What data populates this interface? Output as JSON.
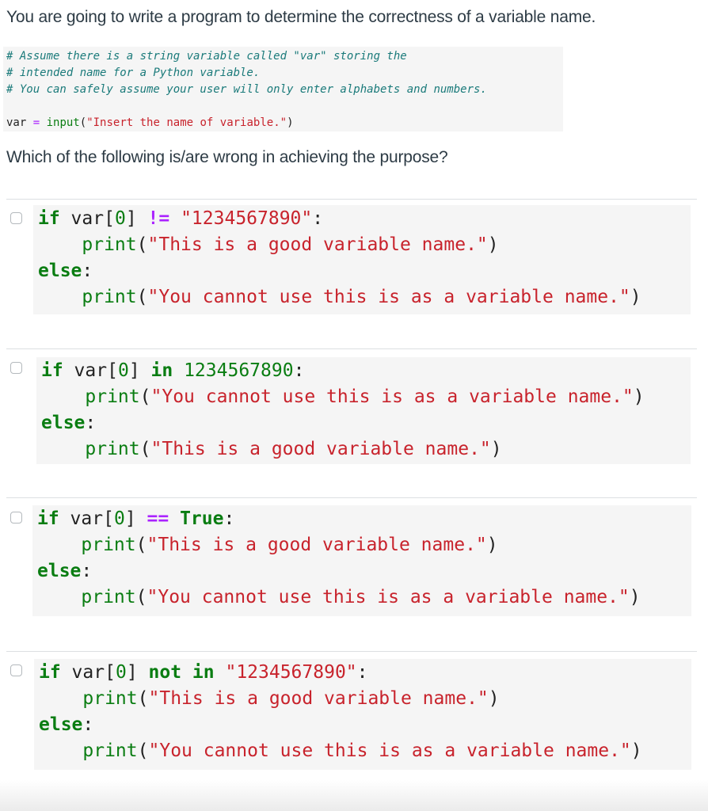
{
  "intro": "You are going to write a program to determine the correctness of a variable name.",
  "snippet": {
    "comments": [
      "# Assume there is a string variable called \"var\" storing the",
      "# intended name for a Python variable.",
      "# You can safely assume your user will only enter alphabets and numbers."
    ],
    "assign": {
      "var": "var",
      "op": " = ",
      "fn": "input",
      "open": "(",
      "str": "\"Insert the name of variable.\"",
      "close": ")"
    }
  },
  "question": "Which of the following is/are wrong in achieving the purpose?",
  "options": [
    {
      "checked": false,
      "line1": [
        {
          "t": "if",
          "c": "kw"
        },
        {
          "t": " var[",
          "c": "plain"
        },
        {
          "t": "0",
          "c": "num"
        },
        {
          "t": "] ",
          "c": "plain"
        },
        {
          "t": "!=",
          "c": "op"
        },
        {
          "t": " ",
          "c": "plain"
        },
        {
          "t": "\"1234567890\"",
          "c": "str"
        },
        {
          "t": ":",
          "c": "plain"
        }
      ],
      "line2": [
        {
          "t": "    ",
          "c": "plain"
        },
        {
          "t": "print",
          "c": "fn"
        },
        {
          "t": "(",
          "c": "plain"
        },
        {
          "t": "\"This is a good variable name.\"",
          "c": "str"
        },
        {
          "t": ")",
          "c": "plain"
        }
      ],
      "line3": [
        {
          "t": "else",
          "c": "kw"
        },
        {
          "t": ":",
          "c": "plain"
        }
      ],
      "line4": [
        {
          "t": "    ",
          "c": "plain"
        },
        {
          "t": "print",
          "c": "fn"
        },
        {
          "t": "(",
          "c": "plain"
        },
        {
          "t": "\"You cannot use this is as a variable name.\"",
          "c": "str"
        },
        {
          "t": ")",
          "c": "plain"
        }
      ]
    },
    {
      "checked": false,
      "line1": [
        {
          "t": "if",
          "c": "kw"
        },
        {
          "t": " var[",
          "c": "plain"
        },
        {
          "t": "0",
          "c": "num"
        },
        {
          "t": "] ",
          "c": "plain"
        },
        {
          "t": "in",
          "c": "kw"
        },
        {
          "t": " ",
          "c": "plain"
        },
        {
          "t": "1234567890",
          "c": "num"
        },
        {
          "t": ":",
          "c": "plain"
        }
      ],
      "line2": [
        {
          "t": "    ",
          "c": "plain"
        },
        {
          "t": "print",
          "c": "fn"
        },
        {
          "t": "(",
          "c": "plain"
        },
        {
          "t": "\"You cannot use this is as a variable name.\"",
          "c": "str"
        },
        {
          "t": ")",
          "c": "plain"
        }
      ],
      "line3": [
        {
          "t": "else",
          "c": "kw"
        },
        {
          "t": ":",
          "c": "plain"
        }
      ],
      "line4": [
        {
          "t": "    ",
          "c": "plain"
        },
        {
          "t": "print",
          "c": "fn"
        },
        {
          "t": "(",
          "c": "plain"
        },
        {
          "t": "\"This is a good variable name.\"",
          "c": "str"
        },
        {
          "t": ")",
          "c": "plain"
        }
      ]
    },
    {
      "checked": false,
      "line1": [
        {
          "t": "if",
          "c": "kw"
        },
        {
          "t": " var[",
          "c": "plain"
        },
        {
          "t": "0",
          "c": "num"
        },
        {
          "t": "] ",
          "c": "plain"
        },
        {
          "t": "==",
          "c": "op"
        },
        {
          "t": " ",
          "c": "plain"
        },
        {
          "t": "True",
          "c": "kw"
        },
        {
          "t": ":",
          "c": "plain"
        }
      ],
      "line2": [
        {
          "t": "    ",
          "c": "plain"
        },
        {
          "t": "print",
          "c": "fn"
        },
        {
          "t": "(",
          "c": "plain"
        },
        {
          "t": "\"This is a good variable name.\"",
          "c": "str"
        },
        {
          "t": ")",
          "c": "plain"
        }
      ],
      "line3": [
        {
          "t": "else",
          "c": "kw"
        },
        {
          "t": ":",
          "c": "plain"
        }
      ],
      "line4": [
        {
          "t": "    ",
          "c": "plain"
        },
        {
          "t": "print",
          "c": "fn"
        },
        {
          "t": "(",
          "c": "plain"
        },
        {
          "t": "\"You cannot use this is as a variable name.\"",
          "c": "str"
        },
        {
          "t": ")",
          "c": "plain"
        }
      ]
    },
    {
      "checked": false,
      "line1": [
        {
          "t": "if",
          "c": "kw"
        },
        {
          "t": " var[",
          "c": "plain"
        },
        {
          "t": "0",
          "c": "num"
        },
        {
          "t": "] ",
          "c": "plain"
        },
        {
          "t": "not in",
          "c": "kw"
        },
        {
          "t": " ",
          "c": "plain"
        },
        {
          "t": "\"1234567890\"",
          "c": "str"
        },
        {
          "t": ":",
          "c": "plain"
        }
      ],
      "line2": [
        {
          "t": "    ",
          "c": "plain"
        },
        {
          "t": "print",
          "c": "fn"
        },
        {
          "t": "(",
          "c": "plain"
        },
        {
          "t": "\"This is a good variable name.\"",
          "c": "str"
        },
        {
          "t": ")",
          "c": "plain"
        }
      ],
      "line3": [
        {
          "t": "else",
          "c": "kw"
        },
        {
          "t": ":",
          "c": "plain"
        }
      ],
      "line4": [
        {
          "t": "    ",
          "c": "plain"
        },
        {
          "t": "print",
          "c": "fn"
        },
        {
          "t": "(",
          "c": "plain"
        },
        {
          "t": "\"You cannot use this is as a variable name.\"",
          "c": "str"
        },
        {
          "t": ")",
          "c": "plain"
        }
      ]
    }
  ]
}
